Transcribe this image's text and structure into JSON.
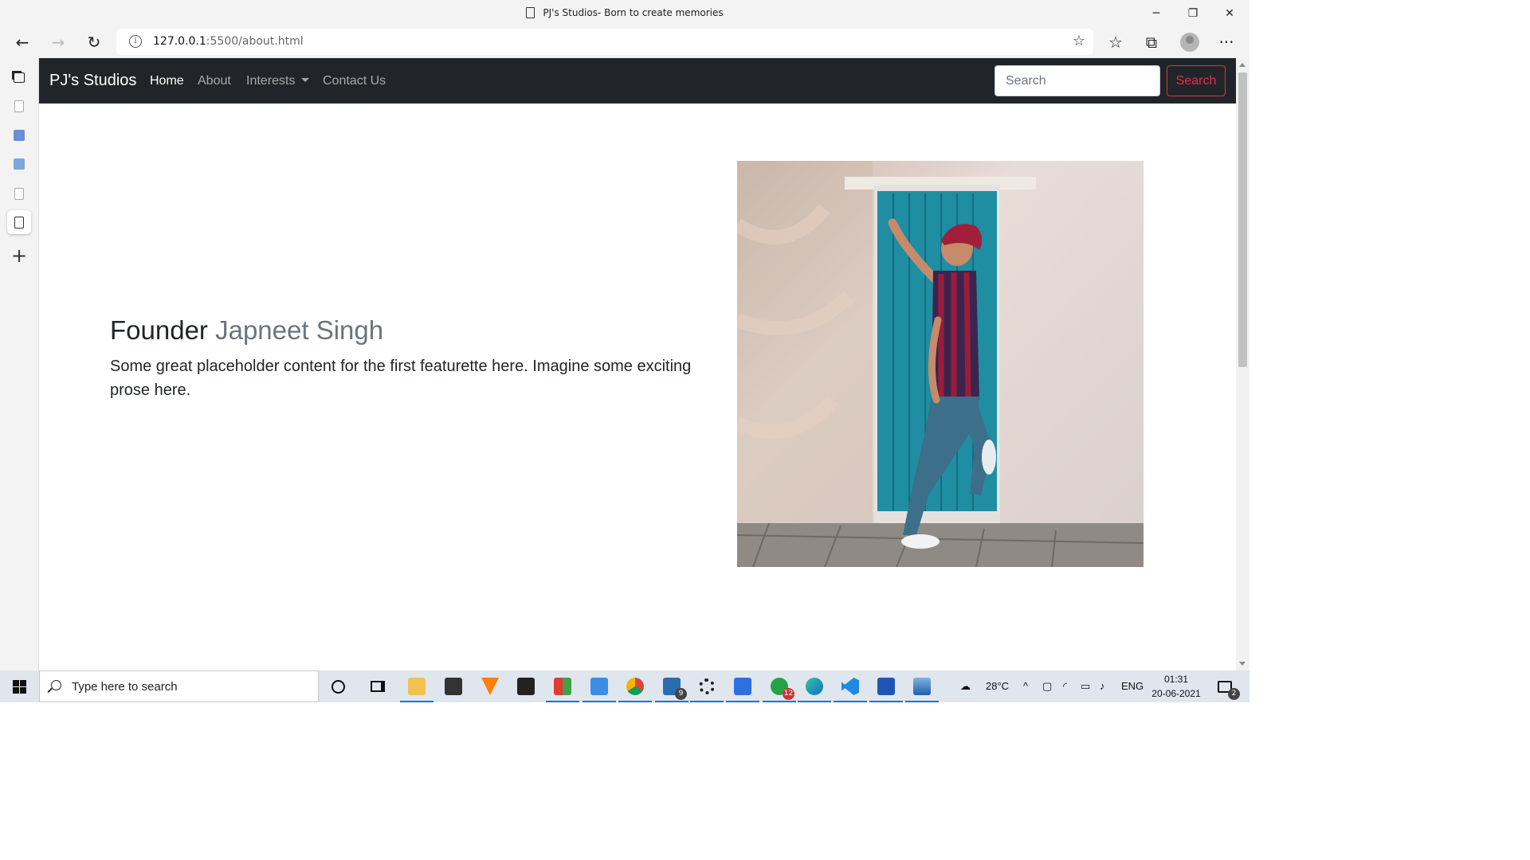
{
  "window": {
    "title": "PJ's Studios- Born to create memories",
    "minimize": "─",
    "restore": "❐",
    "close": "✕"
  },
  "browser": {
    "url_host": "127.0.0.1",
    "url_rest": ":5500/about.html",
    "back": "←",
    "forward": "→",
    "reload": "↻",
    "fav_add": "☆",
    "favorites": "☆",
    "collections": "⧉",
    "more": "···"
  },
  "navbar": {
    "brand": "PJ's Studios",
    "links": [
      "Home",
      "About",
      "Interests",
      "Contact Us"
    ],
    "search_placeholder": "Search",
    "search_button": "Search"
  },
  "featurette": {
    "heading": "Founder",
    "heading_muted": "Japneet Singh",
    "lead": "Some great placeholder content for the first featurette here. Imagine some exciting prose here."
  },
  "taskbar": {
    "search_placeholder": "Type here to search",
    "mail_badge": "9",
    "whatsapp_badge": "12",
    "weather": "28°C",
    "language": "ENG",
    "time": "01:31",
    "date": "20-06-2021",
    "notifications": "2"
  },
  "colors": {
    "navbar_bg": "#212529",
    "accent_danger": "#dc3545",
    "muted_text": "#6c757d"
  }
}
